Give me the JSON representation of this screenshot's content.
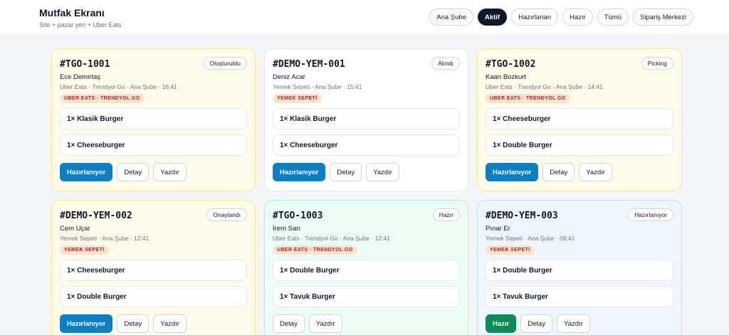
{
  "header": {
    "title": "Mutfak Ekranı",
    "subtitle": "Site + pazar yeri + Uber Eats",
    "filters": [
      {
        "label": "Ana Şube",
        "active": false
      },
      {
        "label": "Aktif",
        "active": true
      },
      {
        "label": "Hazırlanan",
        "active": false
      },
      {
        "label": "Hazır",
        "active": false
      },
      {
        "label": "Tümü",
        "active": false
      },
      {
        "label": "Sipariş Merkezi",
        "active": false
      }
    ]
  },
  "colors": {
    "accent_blue": "#0b7fc1",
    "accent_green": "#0d8a57",
    "dark": "#0f172a"
  },
  "orders": [
    {
      "id": "#TGO-1001",
      "status": "Oluşturuldu",
      "customer": "Ece Demirtaş",
      "meta": "Uber Eats · Trendyol Go · Ana Şube · 16:41",
      "badge": "UBER EATS · TRENDYOL GO",
      "tone": "yellow",
      "items": [
        "1× Klasik Burger",
        "1× Cheeseburger"
      ],
      "actions": [
        {
          "label": "Hazırlanıyor",
          "style": "primary"
        },
        {
          "label": "Detay",
          "style": "default"
        },
        {
          "label": "Yazdır",
          "style": "default"
        }
      ]
    },
    {
      "id": "#DEMO-YEM-001",
      "status": "Alındı",
      "customer": "Deniz Acar",
      "meta": "Yemek Sepeti · Ana Şube · 15:41",
      "badge": "YEMEK SEPETİ",
      "tone": "white",
      "items": [
        "1× Klasik Burger",
        "1× Cheeseburger"
      ],
      "actions": [
        {
          "label": "Hazırlanıyor",
          "style": "primary"
        },
        {
          "label": "Detay",
          "style": "default"
        },
        {
          "label": "Yazdır",
          "style": "default"
        }
      ]
    },
    {
      "id": "#TGO-1002",
      "status": "Picking",
      "customer": "Kaan Bozkurt",
      "meta": "Uber Eats · Trendyol Go · Ana Şube · 14:41",
      "badge": "UBER EATS · TRENDYOL GO",
      "tone": "yellow",
      "items": [
        "1× Cheeseburger",
        "1× Double Burger"
      ],
      "actions": [
        {
          "label": "Hazırlanıyor",
          "style": "primary"
        },
        {
          "label": "Detay",
          "style": "default"
        },
        {
          "label": "Yazdır",
          "style": "default"
        }
      ]
    },
    {
      "id": "#DEMO-YEM-002",
      "status": "Onaylandı",
      "customer": "Cem Uçar",
      "meta": "Yemek Sepeti · Ana Şube · 12:41",
      "badge": "YEMEK SEPETİ",
      "tone": "yellow",
      "items": [
        "1× Cheeseburger",
        "1× Double Burger"
      ],
      "actions": [
        {
          "label": "Hazırlanıyor",
          "style": "primary"
        },
        {
          "label": "Detay",
          "style": "default"
        },
        {
          "label": "Yazdır",
          "style": "default"
        }
      ]
    },
    {
      "id": "#TGO-1003",
      "status": "Hazır",
      "customer": "İrem Sarı",
      "meta": "Uber Eats · Trendyol Go · Ana Şube · 12:41",
      "badge": "UBER EATS · TRENDYOL GO",
      "tone": "green",
      "items": [
        "1× Double Burger",
        "1× Tavuk Burger"
      ],
      "actions": [
        {
          "label": "Detay",
          "style": "default"
        },
        {
          "label": "Yazdır",
          "style": "default"
        }
      ]
    },
    {
      "id": "#DEMO-YEM-003",
      "status": "Hazırlanıyor",
      "customer": "Pınar Er",
      "meta": "Yemek Sepeti · Ana Şube · 09:41",
      "badge": "YEMEK SEPETİ",
      "tone": "blue",
      "items": [
        "1× Double Burger",
        "1× Tavuk Burger"
      ],
      "actions": [
        {
          "label": "Hazır",
          "style": "success"
        },
        {
          "label": "Detay",
          "style": "default"
        },
        {
          "label": "Yazdır",
          "style": "default"
        }
      ]
    }
  ]
}
